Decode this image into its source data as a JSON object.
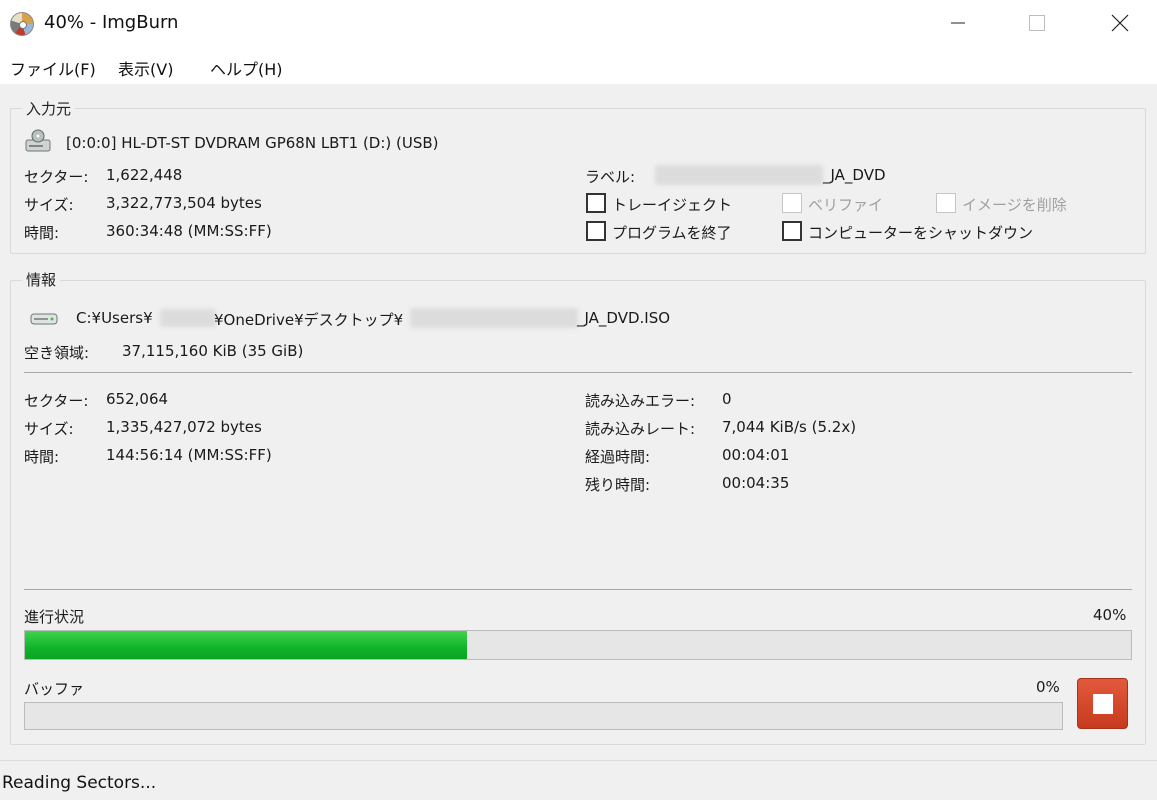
{
  "window": {
    "title": "40% - ImgBurn",
    "minimize_icon": "minimize-icon",
    "maximize_icon": "maximize-icon",
    "close_icon": "close-icon"
  },
  "menu": [
    "ファイル(F)",
    "表示(V)",
    "ヘルプ(H)"
  ],
  "source": {
    "group_title": "入力元",
    "drive": "[0:0:0] HL-DT-ST DVDRAM GP68N LBT1 (D:) (USB)",
    "sectors_label": "セクター:",
    "sectors_value": "1,622,448",
    "size_label": "サイズ:",
    "size_value": "3,322,773,504 bytes",
    "time_label": "時間:",
    "time_value": "360:34:48 (MM:SS:FF)",
    "label_label": "ラベル:",
    "label_value_suffix": "_JA_DVD",
    "checkboxes": {
      "tray_eject": "トレーイジェクト",
      "verify": "ベリファイ",
      "delete_image": "イメージを削除",
      "close_program": "プログラムを終了",
      "shutdown": "コンピューターをシャットダウン"
    }
  },
  "info": {
    "group_title": "情報",
    "path_part1": "C:¥Users¥",
    "path_part2": "¥OneDrive¥デスクトップ¥",
    "path_part3": "_JA_DVD.ISO",
    "free_space_label": "空き領域:",
    "free_space_value": "37,115,160 KiB  (35 GiB)",
    "sectors_label": "セクター:",
    "sectors_value": "652,064",
    "size_label": "サイズ:",
    "size_value": "1,335,427,072 bytes",
    "time_label": "時間:",
    "time_value": "144:56:14 (MM:SS:FF)",
    "read_errors_label": "読み込みエラー:",
    "read_errors_value": "0",
    "read_rate_label": "読み込みレート:",
    "read_rate_value": "7,044 KiB/s (5.2x)",
    "elapsed_label": "経過時間:",
    "elapsed_value": "00:04:01",
    "remaining_label": "残り時間:",
    "remaining_value": "00:04:35"
  },
  "progress": {
    "label": "進行状況",
    "percent_text": "40%",
    "fraction": 0.4
  },
  "buffer": {
    "label": "バッファ",
    "percent_text": "0%",
    "fraction": 0
  },
  "stop_icon": "stop-icon",
  "status": "Reading Sectors...",
  "colors": {
    "progress_fill": "#0fb42a",
    "stop_button": "#c73a1e"
  }
}
